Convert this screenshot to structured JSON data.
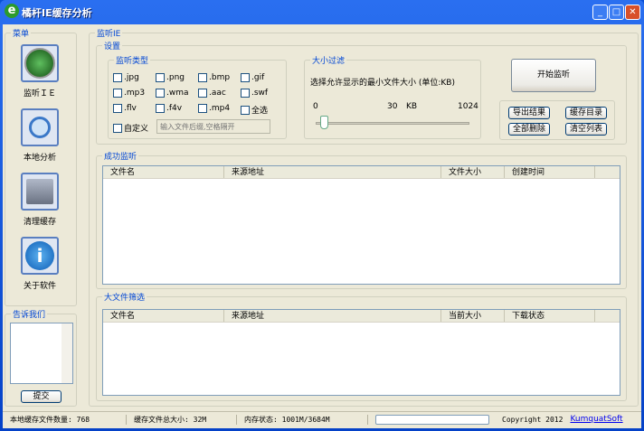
{
  "window": {
    "title": "橘杆IE缓存分析",
    "logo": "e"
  },
  "menu": {
    "legend": "菜单",
    "items": [
      {
        "label": "监听ＩＥ",
        "icon": "radar-icon"
      },
      {
        "label": "本地分析",
        "icon": "magnifier-icon"
      },
      {
        "label": "清理缓存",
        "icon": "shredder-icon"
      },
      {
        "label": "关于软件",
        "icon": "info-icon"
      }
    ]
  },
  "feedback": {
    "legend": "告诉我们",
    "submit": "提交"
  },
  "main": {
    "legend": "监听IE",
    "settings": {
      "legend": "设置",
      "types": {
        "legend": "监听类型",
        "items": [
          ".jpg",
          ".png",
          ".bmp",
          ".gif",
          ".mp3",
          ".wma",
          ".aac",
          ".swf",
          ".flv",
          ".f4v",
          ".mp4",
          "全选"
        ],
        "custom_label": "自定义",
        "custom_placeholder": "输入文件后缀,空格隔开"
      },
      "size": {
        "legend": "大小过滤",
        "desc": "选择允许显示的最小文件大小 (单位:KB)",
        "min": "0",
        "value": "30",
        "unit": "KB",
        "max": "1024",
        "fraction": 0.03
      },
      "start": "开始监听",
      "export": "导出结果",
      "cache_dir": "缓存目录",
      "delete_all": "全部删除",
      "clear_list": "清空列表"
    },
    "success": {
      "legend": "成功监听",
      "cols": [
        "文件名",
        "来源地址",
        "文件大小",
        "创建时间"
      ]
    },
    "big": {
      "legend": "大文件筛选",
      "cols": [
        "文件名",
        "来源地址",
        "当前大小",
        "下载状态"
      ]
    }
  },
  "status": {
    "count": "本地缓存文件数量: 768",
    "total": "缓存文件总大小: 32M",
    "memory": "内存状态: 1001M/3684M",
    "copyright": "Copyright 2012",
    "link": "KumquatSoft"
  }
}
